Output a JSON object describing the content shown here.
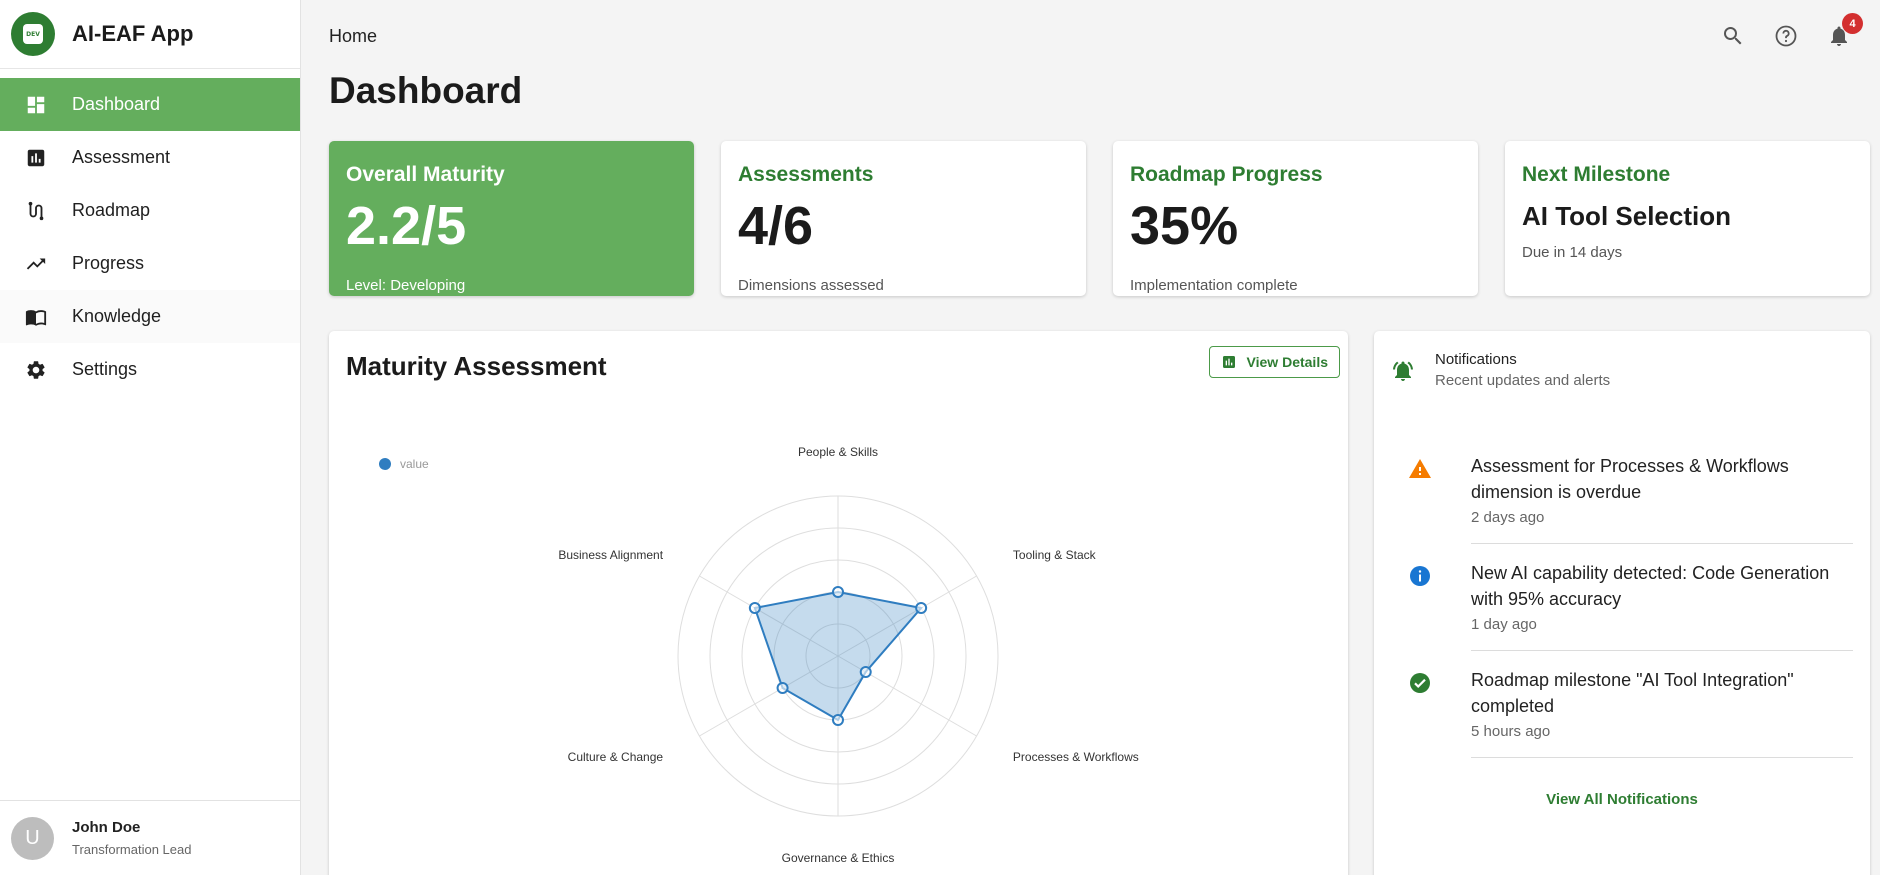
{
  "app": {
    "title": "AI-EAF App",
    "logo_text": "DEV",
    "accent": "#64ae5d",
    "brand_dark": "#2e7d32"
  },
  "sidebar": {
    "items": [
      {
        "label": "Dashboard",
        "icon": "dashboard-icon",
        "active": true
      },
      {
        "label": "Assessment",
        "icon": "bar-chart-icon"
      },
      {
        "label": "Roadmap",
        "icon": "route-icon"
      },
      {
        "label": "Progress",
        "icon": "trending-up-icon"
      },
      {
        "label": "Knowledge",
        "icon": "book-icon"
      },
      {
        "label": "Settings",
        "icon": "gear-icon"
      }
    ]
  },
  "user": {
    "initial": "U",
    "name": "John Doe",
    "role": "Transformation Lead"
  },
  "header": {
    "breadcrumb": "Home",
    "page_title": "Dashboard",
    "notification_count": "4"
  },
  "stats": [
    {
      "title": "Overall Maturity",
      "value": "2.2/5",
      "sub": "Level: Developing"
    },
    {
      "title": "Assessments",
      "value": "4/6",
      "sub": "Dimensions assessed"
    },
    {
      "title": "Roadmap Progress",
      "value": "35%",
      "sub": "Implementation complete"
    },
    {
      "title": "Next Milestone",
      "value": "AI Tool Selection",
      "sub": "Due in 14 days"
    }
  ],
  "maturity": {
    "title": "Maturity Assessment",
    "view_details": "View Details"
  },
  "chart_data": {
    "type": "radar",
    "legend": [
      "value"
    ],
    "categories": [
      "People & Skills",
      "Tooling & Stack",
      "Processes & Workflows",
      "Governance & Ethics",
      "Culture & Change",
      "Business Alignment"
    ],
    "series": [
      {
        "name": "value",
        "values": [
          2,
          3,
          1,
          2,
          2,
          3
        ]
      }
    ],
    "rlim": [
      0,
      5
    ],
    "color": "#2f7dc0"
  },
  "notifications": {
    "title": "Notifications",
    "subtitle": "Recent updates and alerts",
    "items": [
      {
        "icon": "warning-icon",
        "message": "Assessment for Processes & Workflows dimension is overdue",
        "time": "2 days ago"
      },
      {
        "icon": "info-icon",
        "message": "New AI capability detected: Code Generation with 95% accuracy",
        "time": "1 day ago"
      },
      {
        "icon": "check-circle-icon",
        "message": "Roadmap milestone \"AI Tool Integration\" completed",
        "time": "5 hours ago"
      }
    ],
    "view_all": "View All Notifications"
  }
}
